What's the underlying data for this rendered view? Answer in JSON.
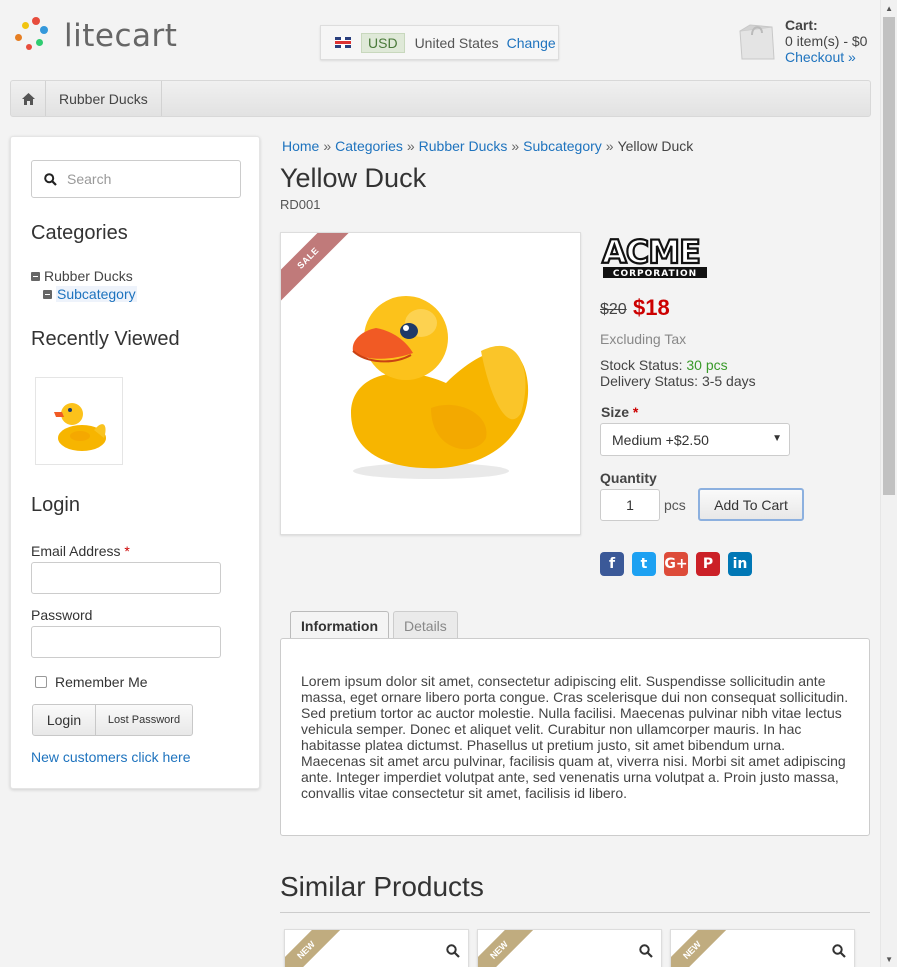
{
  "header": {
    "logo_text": "litecart",
    "region": {
      "currency": "USD",
      "country": "United States",
      "change_label": "Change"
    },
    "cart": {
      "title": "Cart:",
      "summary": "0 item(s) - $0",
      "checkout_label": "Checkout »"
    }
  },
  "nav": {
    "items": [
      {
        "label": "Rubber Ducks"
      }
    ]
  },
  "sidebar": {
    "search_placeholder": "Search",
    "categories_heading": "Categories",
    "categories": [
      {
        "label": "Rubber Ducks"
      },
      {
        "label": "Subcategory"
      }
    ],
    "recently_viewed_heading": "Recently Viewed",
    "login": {
      "heading": "Login",
      "email_label": "Email Address",
      "password_label": "Password",
      "remember_label": "Remember Me",
      "login_button": "Login",
      "lost_password_button": "Lost Password",
      "new_customers_link": "New customers click here"
    }
  },
  "breadcrumb": {
    "items": [
      "Home",
      "Categories",
      "Rubber Ducks",
      "Subcategory"
    ],
    "current": "Yellow Duck",
    "separator": "»"
  },
  "product": {
    "name": "Yellow Duck",
    "sku": "RD001",
    "sale_badge": "SALE",
    "price_old": "$20",
    "price_new": "$18",
    "tax_note": "Excluding Tax",
    "stock_label": "Stock Status:",
    "stock_value": "30 pcs",
    "delivery_label": "Delivery Status:",
    "delivery_value": "3-5 days",
    "size_label": "Size",
    "size_selected": "Medium +$2.50",
    "quantity_label": "Quantity",
    "quantity_value": "1",
    "quantity_unit": "pcs",
    "add_to_cart": "Add To Cart"
  },
  "social": [
    {
      "icon": "facebook-icon",
      "glyph": "f",
      "color": "#3b5998"
    },
    {
      "icon": "twitter-icon",
      "glyph": "t",
      "color": "#1da1f2"
    },
    {
      "icon": "google-plus-icon",
      "glyph": "G+",
      "color": "#dd4b39"
    },
    {
      "icon": "pinterest-icon",
      "glyph": "P",
      "color": "#cb2027"
    },
    {
      "icon": "linkedin-icon",
      "glyph": "in",
      "color": "#0077b5"
    }
  ],
  "tabs": {
    "information": "Information",
    "details": "Details"
  },
  "description": "Lorem ipsum dolor sit amet, consectetur adipiscing elit. Suspendisse sollicitudin ante massa, eget ornare libero porta congue. Cras scelerisque dui non consequat sollicitudin. Sed pretium tortor ac auctor molestie. Nulla facilisi. Maecenas pulvinar nibh vitae lectus vehicula semper. Donec et aliquet velit. Curabitur non ullamcorper mauris. In hac habitasse platea dictumst. Phasellus ut pretium justo, sit amet bibendum urna. Maecenas sit amet arcu pulvinar, facilisis quam at, viverra nisi. Morbi sit amet adipiscing ante. Integer imperdiet volutpat ante, sed venenatis urna volutpat a. Proin justo massa, convallis vitae consectetur sit amet, facilisis id libero.",
  "similar": {
    "heading": "Similar Products",
    "badge": "NEW"
  },
  "colors": {
    "link": "#1e73be",
    "price": "#cc0000",
    "stock": "#3a9a2a",
    "sale_ribbon": "#c07a7a",
    "new_ribbon": "#c0ac7f"
  }
}
